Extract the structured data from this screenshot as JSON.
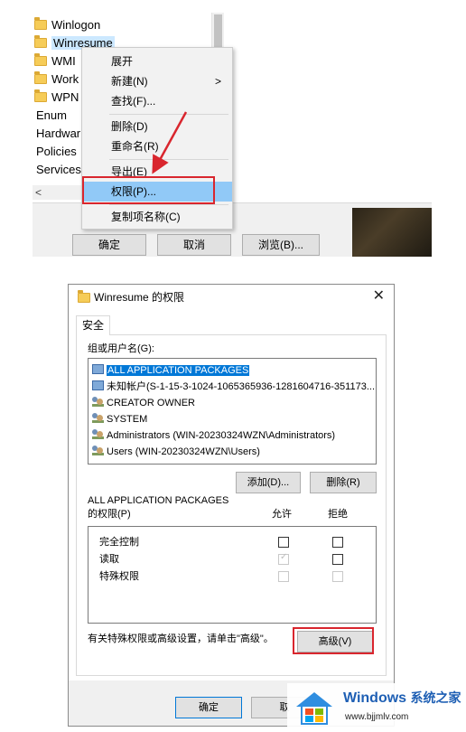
{
  "registry_tree": {
    "items": [
      {
        "label": "Winlogon",
        "folder": true
      },
      {
        "label": "Winresume",
        "folder": true,
        "selected": true
      },
      {
        "label": "WMI",
        "folder": true
      },
      {
        "label": "Work",
        "folder": true
      },
      {
        "label": "WPN",
        "folder": true
      },
      {
        "label": "Enum",
        "folder": false
      },
      {
        "label": "Hardwar",
        "folder": false
      },
      {
        "label": "Policies",
        "folder": false
      },
      {
        "label": "Services",
        "folder": false
      }
    ],
    "scroll_left": "<"
  },
  "context_menu": {
    "items": [
      {
        "label": "展开"
      },
      {
        "label": "新建(N)",
        "submenu_arrow": ">"
      },
      {
        "label": "查找(F)..."
      },
      {
        "label": "删除(D)"
      },
      {
        "label": "重命名(R)"
      },
      {
        "label": "导出(E)"
      },
      {
        "label": "权限(P)...",
        "highlighted": true
      },
      {
        "label": "复制项名称(C)"
      }
    ]
  },
  "top_dialog_buttons": {
    "ok": "确定",
    "cancel": "取消",
    "browse": "浏览(B)..."
  },
  "permissions_dialog": {
    "title": "Winresume 的权限",
    "close_symbol": "✕",
    "tab": "安全",
    "groups_label": "组或用户名(G):",
    "users": [
      {
        "name": "ALL APPLICATION PACKAGES",
        "icon": "package-icon",
        "selected": true
      },
      {
        "name": "未知帐户(S-1-15-3-1024-1065365936-1281604716-351173...",
        "icon": "package-icon"
      },
      {
        "name": "CREATOR OWNER",
        "icon": "users-icon"
      },
      {
        "name": "SYSTEM",
        "icon": "users-icon"
      },
      {
        "name": "Administrators (WIN-20230324WZN\\Administrators)",
        "icon": "users-icon"
      },
      {
        "name": "Users (WIN-20230324WZN\\Users)",
        "icon": "users-icon"
      }
    ],
    "add_button": "添加(D)...",
    "remove_button": "删除(R)",
    "perm_for_label_line1": "ALL APPLICATION PACKAGES",
    "perm_for_label_line2": "的权限(P)",
    "allow_header": "允许",
    "deny_header": "拒绝",
    "permissions": [
      {
        "name": "完全控制",
        "allow": false,
        "deny": false,
        "disabled": false
      },
      {
        "name": "读取",
        "allow": true,
        "deny": false,
        "disabled_allow": true
      },
      {
        "name": "特殊权限",
        "allow": false,
        "deny": false,
        "disabled": true
      }
    ],
    "advanced_hint": "有关特殊权限或高级设置，请单击\"高级\"。",
    "advanced_button": "高级(V)",
    "ok_button": "确定",
    "cancel_button": "取"
  },
  "watermark": {
    "brand": "Windows",
    "brand_suffix": "系统之家",
    "url": "www.bjjmlv.com"
  },
  "colors": {
    "highlight_red": "#d9262e",
    "selection_blue": "#0078d7",
    "menu_highlight": "#91c9f7"
  }
}
